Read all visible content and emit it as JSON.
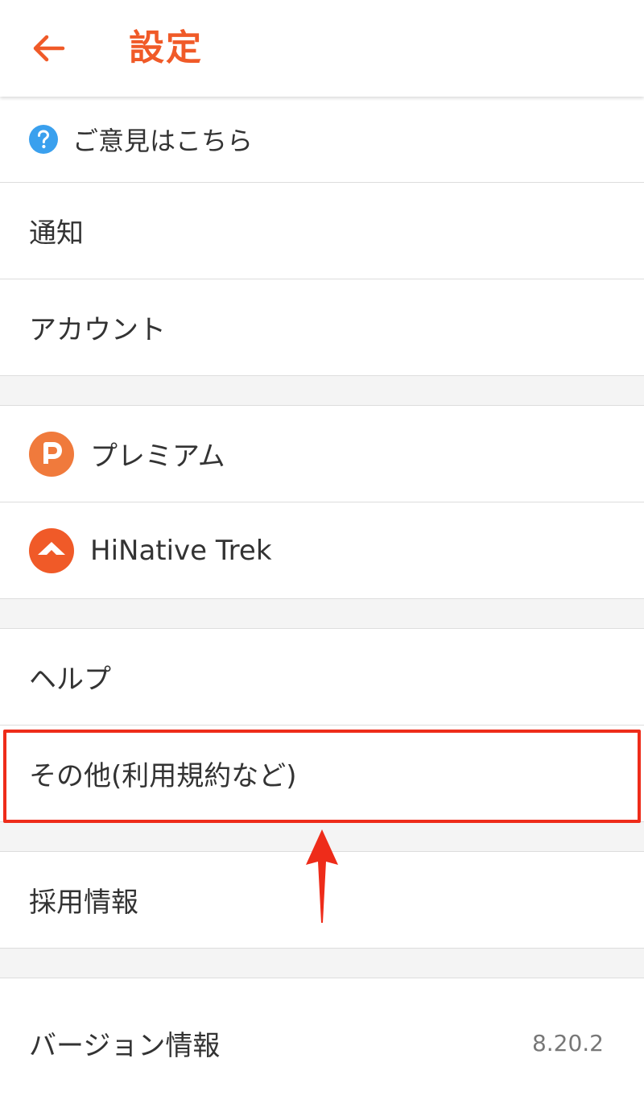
{
  "header": {
    "title": "設定",
    "back_icon": "arrow-left-icon",
    "accent_color": "#f05a28"
  },
  "sections": [
    {
      "items": [
        {
          "id": "feedback",
          "label": "ご意見はこちら",
          "icon": "question-circle-icon",
          "icon_color": "#3aa0ee"
        },
        {
          "id": "notifications",
          "label": "通知"
        },
        {
          "id": "account",
          "label": "アカウント"
        }
      ]
    },
    {
      "items": [
        {
          "id": "premium",
          "label": "プレミアム",
          "icon": "premium-p-icon",
          "icon_color": "#f07a3c"
        },
        {
          "id": "trek",
          "label": "HiNative Trek",
          "icon": "trek-mountain-icon",
          "icon_color": "#f05a28"
        }
      ]
    },
    {
      "items": [
        {
          "id": "help",
          "label": "ヘルプ"
        },
        {
          "id": "other",
          "label": "その他(利用規約など)"
        }
      ]
    },
    {
      "items": [
        {
          "id": "jobs",
          "label": "採用情報"
        }
      ]
    },
    {
      "items": [
        {
          "id": "version",
          "label": "バージョン情報",
          "value": "8.20.2"
        }
      ]
    }
  ],
  "annotation": {
    "highlight_color": "#ee2c1a",
    "highlighted_item": "other",
    "arrow_icon": "up-arrow-annotation-icon"
  }
}
